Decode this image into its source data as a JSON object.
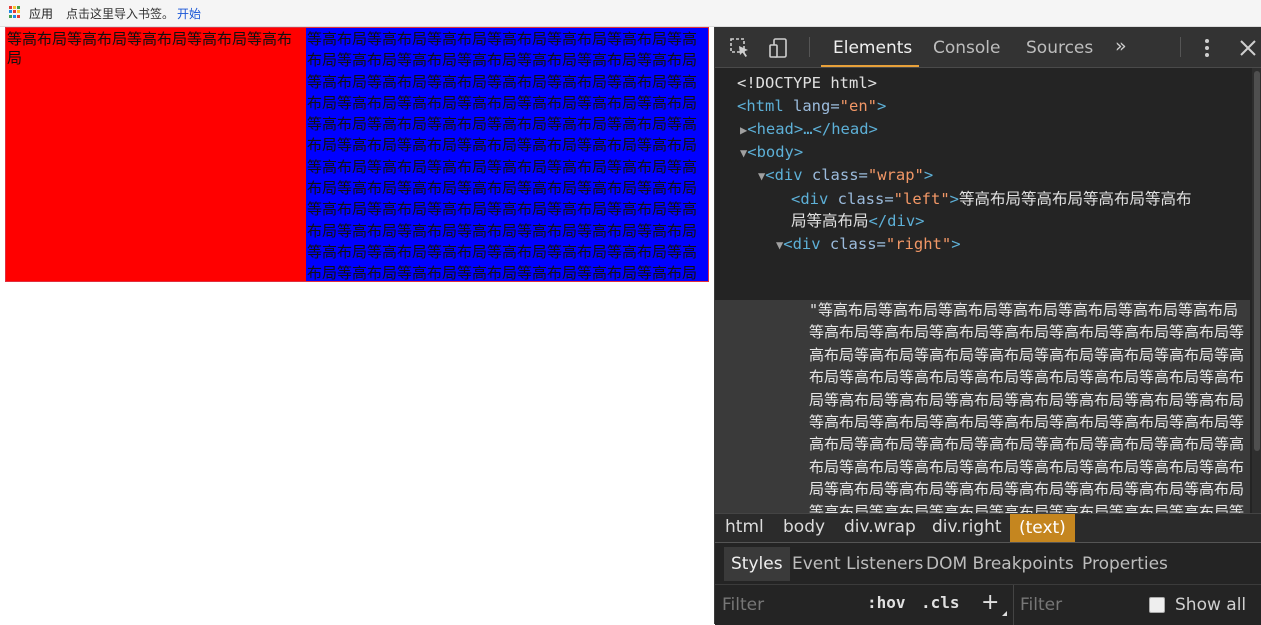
{
  "bookmarks": {
    "apps_label": "应用",
    "hint": "点击这里导入书签。",
    "start": "开始"
  },
  "page": {
    "left_text": "等高布局等高布局等高布局等高布局等高布局",
    "right_text": "等高布局等高布局等高布局等高布局等高布局等高布局等高布局等高布局等高布局等高布局等高布局等高布局等高布局等高布局等高布局等高布局等高布局等高布局等高布局等高布局等高布局等高布局等高布局等高布局等高布局等高布局等高布局等高布局等高布局等高布局等高布局等高布局等高布局等高布局等高布局等高布局等高布局等高布局等高布局等高布局等高布局等高布局等高布局等高布局等高布局等高布局等高布局等高布局等高布局等高布局等高布局等高布局等高布局等高布局等高布局等高布局等高布局等高布局等高布局等高布局等高布局等高布局等高布局等高布局等高布局等高布局等高布局等高布局等高布局等高布局等高布局等高布局等高布局等高布局等高布局等高布局等高布局等高布局等高布局等高布局等高布局等高布局等高布局等高布局等高布局等高布局等高布局等高布局等高布局等高布局等高布局"
  },
  "devtools": {
    "tabs": [
      "Elements",
      "Console",
      "Sources"
    ],
    "more": "»",
    "dom": {
      "doctype": "<!DOCTYPE html>",
      "html_open_tag": "<html",
      "html_attr": " lang=",
      "html_attr_val": "\"en\"",
      "html_close": ">",
      "head": "<head>…</head>",
      "body_open": "<body>",
      "wrap_open_tag": "<div",
      "class_attr": " class=",
      "wrap_val": "\"wrap\"",
      "gt": ">",
      "left_val": "\"left\"",
      "left_text_line1": "等高布局等高布局等高布局等高布",
      "left_text_line2": "局等高布局",
      "div_close": "</div>",
      "right_val": "\"right\"",
      "right_text": "\"等高布局等高布局等高布局等高布局等高布局等高布局等高布局等高布局等高布局等高布局等高布局等高布局等高布局等高布局等高布局等高布局等高布局等高布局等高布局等高布局等高布局等高布局等高布局等高布局等高布局等高布局等高布局等高布局等高布局等高布局等高布局等高布局等高布局等高布局等高布局等高布局等高布局等高布局等高布局等高布局等高布局等高布局等高布局等高布局等高布局等高布局等高布局等高布局等高布局等高布局等高布局等高布局等高布局等高布局等高布局等高布局等高布局等高布局等高布局等高布局等高布局等高布局等高布局等高布局等高布局等高布局等高布局等高布局等高布局等高布局等高布局等高布局等高布局等高布局等高布局\""
    },
    "breadcrumbs": [
      "html",
      "body",
      "div.wrap",
      "div.right",
      "(text)"
    ],
    "lower_tabs": [
      "Styles",
      "Event Listeners",
      "DOM Breakpoints",
      "Properties"
    ],
    "filter_placeholder": "Filter",
    "hov": ":hov",
    "cls": ".cls",
    "plus": "+",
    "filter2_placeholder": "Filter",
    "show_all": "Show all"
  }
}
